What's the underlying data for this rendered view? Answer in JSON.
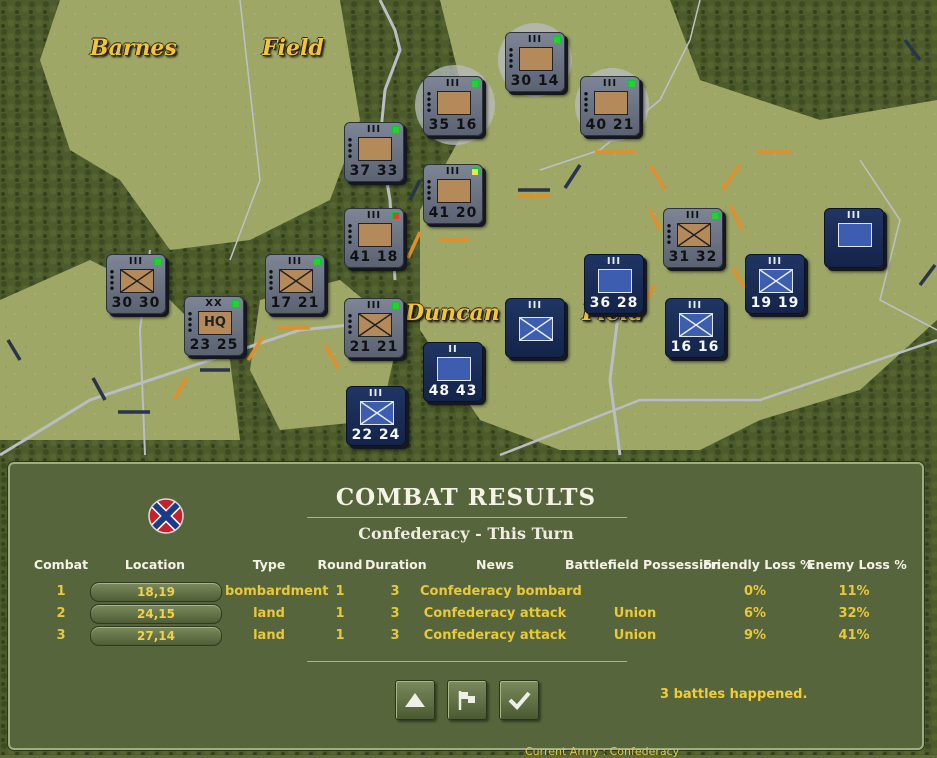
{
  "map": {
    "place_labels": [
      "Barnes",
      "Field",
      "Duncan",
      "Field"
    ],
    "units": [
      {
        "id": "u1",
        "side": "confederate",
        "size": "III",
        "strength": "30 14",
        "type": "artillery"
      },
      {
        "id": "u2",
        "side": "confederate",
        "size": "III",
        "strength": "35 16",
        "type": "artillery"
      },
      {
        "id": "u3",
        "side": "confederate",
        "size": "III",
        "strength": "40 21",
        "type": "artillery"
      },
      {
        "id": "u4",
        "side": "confederate",
        "size": "III",
        "strength": "37 33",
        "type": "artillery"
      },
      {
        "id": "u5",
        "side": "confederate",
        "size": "III",
        "strength": "41 20",
        "type": "artillery"
      },
      {
        "id": "u6",
        "side": "confederate",
        "size": "III",
        "strength": "41 18",
        "type": "artillery"
      },
      {
        "id": "u7",
        "side": "confederate",
        "size": "III",
        "strength": "30 30",
        "type": "infantry"
      },
      {
        "id": "u8",
        "side": "confederate",
        "size": "XX",
        "strength": "23 25",
        "type": "hq",
        "label": "HQ"
      },
      {
        "id": "u9",
        "side": "confederate",
        "size": "III",
        "strength": "17 21",
        "type": "infantry"
      },
      {
        "id": "u10",
        "side": "confederate",
        "size": "III",
        "strength": "21 21",
        "type": "infantry"
      },
      {
        "id": "u11",
        "side": "confederate",
        "size": "III",
        "strength": "31 32",
        "type": "infantry"
      },
      {
        "id": "u12",
        "side": "union",
        "size": "III",
        "strength": "36 28",
        "type": "artillery"
      },
      {
        "id": "u13",
        "side": "union",
        "size": "III",
        "strength": "",
        "type": "infantry"
      },
      {
        "id": "u14",
        "side": "union",
        "size": "II",
        "strength": "48 43",
        "type": "artillery"
      },
      {
        "id": "u15",
        "side": "union",
        "size": "III",
        "strength": "22 24",
        "type": "infantry"
      },
      {
        "id": "u16",
        "side": "union",
        "size": "III",
        "strength": "16 16",
        "type": "infantry"
      },
      {
        "id": "u17",
        "side": "union",
        "size": "III",
        "strength": "19 19",
        "type": "infantry"
      },
      {
        "id": "u18",
        "side": "union",
        "size": "III",
        "strength": "",
        "type": "artillery"
      }
    ]
  },
  "panel": {
    "title": "COMBAT RESULTS",
    "subtitle": "Confederacy - This Turn",
    "headers": [
      "Combat",
      "Location",
      "Type",
      "Round",
      "Duration",
      "News",
      "Battlefield Possession",
      "Friendly Loss %",
      "Enemy Loss %"
    ],
    "rows": [
      {
        "combat": "1",
        "location": "18,19",
        "type": "bombardment",
        "round": "1",
        "duration": "3",
        "news": "Confederacy bombard",
        "possession": "",
        "friendly_loss": "0%",
        "enemy_loss": "11%"
      },
      {
        "combat": "2",
        "location": "24,15",
        "type": "land",
        "round": "1",
        "duration": "3",
        "news": "Confederacy attack",
        "possession": "Union",
        "friendly_loss": "6%",
        "enemy_loss": "32%"
      },
      {
        "combat": "3",
        "location": "27,14",
        "type": "land",
        "round": "1",
        "duration": "3",
        "news": "Confederacy attack",
        "possession": "Union",
        "friendly_loss": "9%",
        "enemy_loss": "41%"
      }
    ],
    "buttons": [
      {
        "name": "up-arrow-icon"
      },
      {
        "name": "flag-icon"
      },
      {
        "name": "checkmark-icon"
      }
    ],
    "footer": "3 battles happened."
  },
  "status_bar": "Current Army : Confederacy",
  "colors": {
    "panel_bg": "#56653b",
    "accent_text": "#e9c83a",
    "confederate_counter": "#6b7383",
    "union_counter": "#1a2d58"
  }
}
